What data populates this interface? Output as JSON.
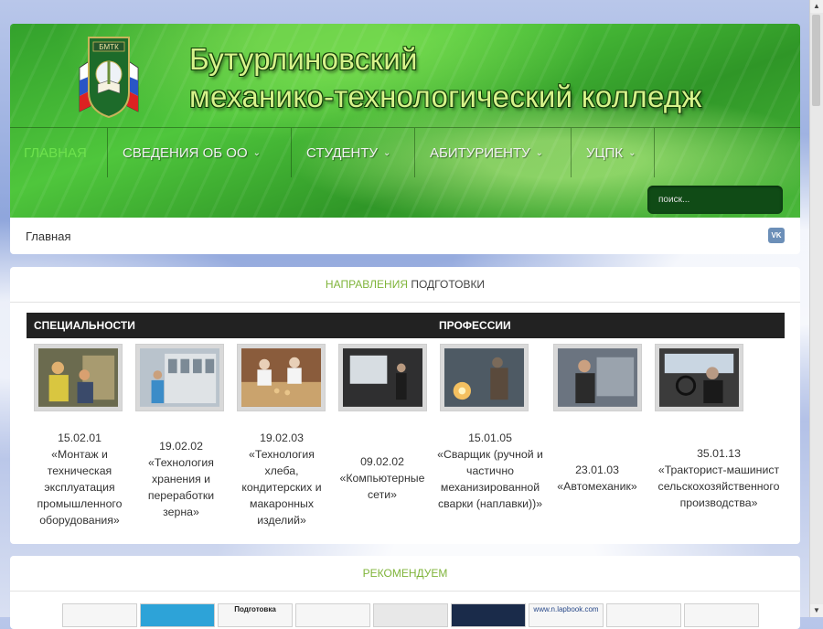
{
  "site": {
    "title_line1": "Бутурлиновский",
    "title_line2": "механико-технологический колледж",
    "logo_text": "БМТК"
  },
  "nav": [
    {
      "label": "ГЛАВНАЯ",
      "active": true
    },
    {
      "label": "СВЕДЕНИЯ ОБ ОО",
      "dropdown": true
    },
    {
      "label": "СТУДЕНТУ",
      "dropdown": true
    },
    {
      "label": "АБИТУРИЕНТУ",
      "dropdown": true
    },
    {
      "label": "УЦПК",
      "dropdown": true
    }
  ],
  "search": {
    "placeholder": "поиск..."
  },
  "breadcrumb": "Главная",
  "social": {
    "vk": "VK"
  },
  "directions": {
    "title_accent": "НАПРАВЛЕНИЯ",
    "title_rest": " ПОДГОТОВКИ",
    "col_specialties": "СПЕЦИАЛЬНОСТИ",
    "col_professions": "ПРОФЕССИИ",
    "items": [
      {
        "code": "15.02.01",
        "name": "«Монтаж и техническая эксплуатация промышленного оборудования»"
      },
      {
        "code": "19.02.02",
        "name": "«Технология хранения и переработки зерна»"
      },
      {
        "code": "19.02.03",
        "name": "«Технология хлеба, кондитерских и макаронных изделий»"
      },
      {
        "code": "09.02.02",
        "name": "«Компьютерные сети»"
      },
      {
        "code": "15.01.05",
        "name": "«Сварщик (ручной и частично механизированной сварки (наплавки))»"
      },
      {
        "code": "23.01.03",
        "name": "«Автомеханик»"
      },
      {
        "code": "35.01.13",
        "name": "«Тракторист-машинист сельскохозяйственного производства»"
      }
    ]
  },
  "recommend": {
    "title": "РЕКОМЕНДУЕМ",
    "banners": [
      "",
      "",
      "Подготовка",
      "",
      "",
      "",
      "www.n.lapbook.com",
      "",
      ""
    ]
  },
  "colors": {
    "accent": "#7fb43a",
    "nav_active": "#6ee24d",
    "header_green": "#3fae34"
  }
}
